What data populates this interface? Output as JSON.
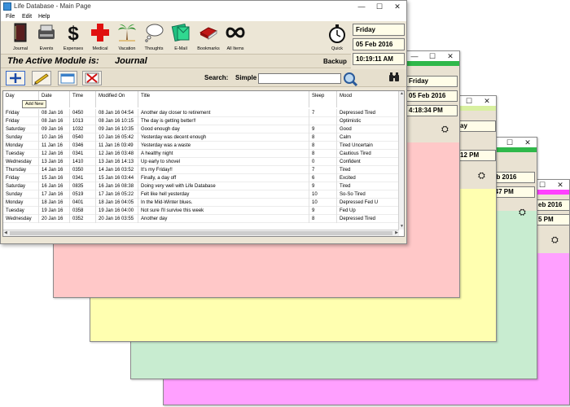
{
  "window": {
    "title": "Life Database - Main Page",
    "menu": [
      "File",
      "Edit",
      "Help"
    ]
  },
  "toolbar": {
    "items": [
      {
        "label": "Journal",
        "icon": "journal-book-icon"
      },
      {
        "label": "Events",
        "icon": "typewriter-icon"
      },
      {
        "label": "Expenses",
        "icon": "dollar-icon"
      },
      {
        "label": "Medical",
        "icon": "red-cross-icon"
      },
      {
        "label": "Vacation",
        "icon": "palm-tree-icon"
      },
      {
        "label": "Thoughts",
        "icon": "thought-cloud-icon"
      },
      {
        "label": "E-Mail",
        "icon": "email-icon"
      },
      {
        "label": "Bookmarks",
        "icon": "bookmarks-icon"
      },
      {
        "label": "All Items",
        "icon": "infinity-icon"
      }
    ],
    "quick_label": "Quick"
  },
  "date": {
    "day": "Friday",
    "date": "05 Feb 2016",
    "time": "10:19:11 AM"
  },
  "module": {
    "label": "The Active Module is:",
    "value": "Journal",
    "backup_label": "Backup"
  },
  "search": {
    "label": "Search:",
    "mode": "Simple",
    "value": ""
  },
  "tooltip": "Add New",
  "grid": {
    "columns": [
      "Day",
      "Date",
      "Time",
      "Modified On",
      "Title",
      "Sleep",
      "Mood"
    ],
    "rows": [
      [
        "Friday",
        "08 Jan 16",
        "0450",
        "08 Jan 16 04:54",
        "Another day closer to retirement",
        "7",
        "Depressed Tired"
      ],
      [
        "Friday",
        "08 Jan 16",
        "1013",
        "08 Jan 16 10:15",
        "The day is getting better!!",
        "",
        "Optimistic"
      ],
      [
        "Saturday",
        "09 Jan 16",
        "1032",
        "09 Jan 16 10:35",
        "Good enough day",
        "9",
        "Good"
      ],
      [
        "Sunday",
        "10 Jan 16",
        "0540",
        "10 Jan 16 05:42",
        "Yesterday was decent enough",
        "8",
        "Calm"
      ],
      [
        "Monday",
        "11 Jan 16",
        "0346",
        "11 Jan 16 03:49",
        "Yesterday was a waste",
        "8",
        "Tired Uncertain"
      ],
      [
        "Tuesday",
        "12 Jan 16",
        "0341",
        "12 Jan 16 03:48",
        "A healthy night",
        "8",
        "Cautious Tired"
      ],
      [
        "Wednesday",
        "13 Jan 16",
        "1410",
        "13 Jan 16 14:13",
        "Up early to shovel",
        "0",
        "Confident"
      ],
      [
        "Thursday",
        "14 Jan 16",
        "0350",
        "14 Jan 16 03:52",
        "It's my Friday!!",
        "7",
        "Tired"
      ],
      [
        "Friday",
        "15 Jan 16",
        "0341",
        "15 Jan 16 03:44",
        "Finally, a day off",
        "6",
        "Excited"
      ],
      [
        "Saturday",
        "16 Jan 16",
        "0835",
        "16 Jan 16 08:38",
        "Doing very well with Life Database",
        "9",
        "Tired"
      ],
      [
        "Sunday",
        "17 Jan 16",
        "0519",
        "17 Jan 16 05:22",
        "Felt like hell yesterday",
        "10",
        "So-So Tired"
      ],
      [
        "Monday",
        "18 Jan 16",
        "0401",
        "18 Jan 16 04:05",
        "In the Mid-Winter blues.",
        "10",
        "Depressed Fed U"
      ],
      [
        "Tuesday",
        "19 Jan 16",
        "0358",
        "19 Jan 16 04:00",
        "Not sure I'll survive this week",
        "9",
        "Fed Up"
      ],
      [
        "Wednesday",
        "20 Jan 16",
        "0352",
        "20 Jan 16 03:55",
        "Another day",
        "8",
        "Depressed Tired"
      ]
    ]
  },
  "windows": [
    {
      "day": "Friday",
      "date": "05 Feb 2016",
      "time": "4:18:34 PM"
    },
    {
      "day": "ay",
      "date": "eb 2016",
      "time": "12 PM"
    },
    {
      "day": "",
      "date": "eb 2016",
      "time": ":47 PM"
    },
    {
      "day": "",
      "date": "eb 2016",
      "time": "5 PM"
    }
  ],
  "colors": {
    "pink": "#ffc8c8",
    "yellow": "#ffffb0",
    "green": "#c8ecd0",
    "magenta": "#ffa0ff",
    "green_strip": "#2fb84a",
    "magenta_strip": "#ff40ff"
  }
}
